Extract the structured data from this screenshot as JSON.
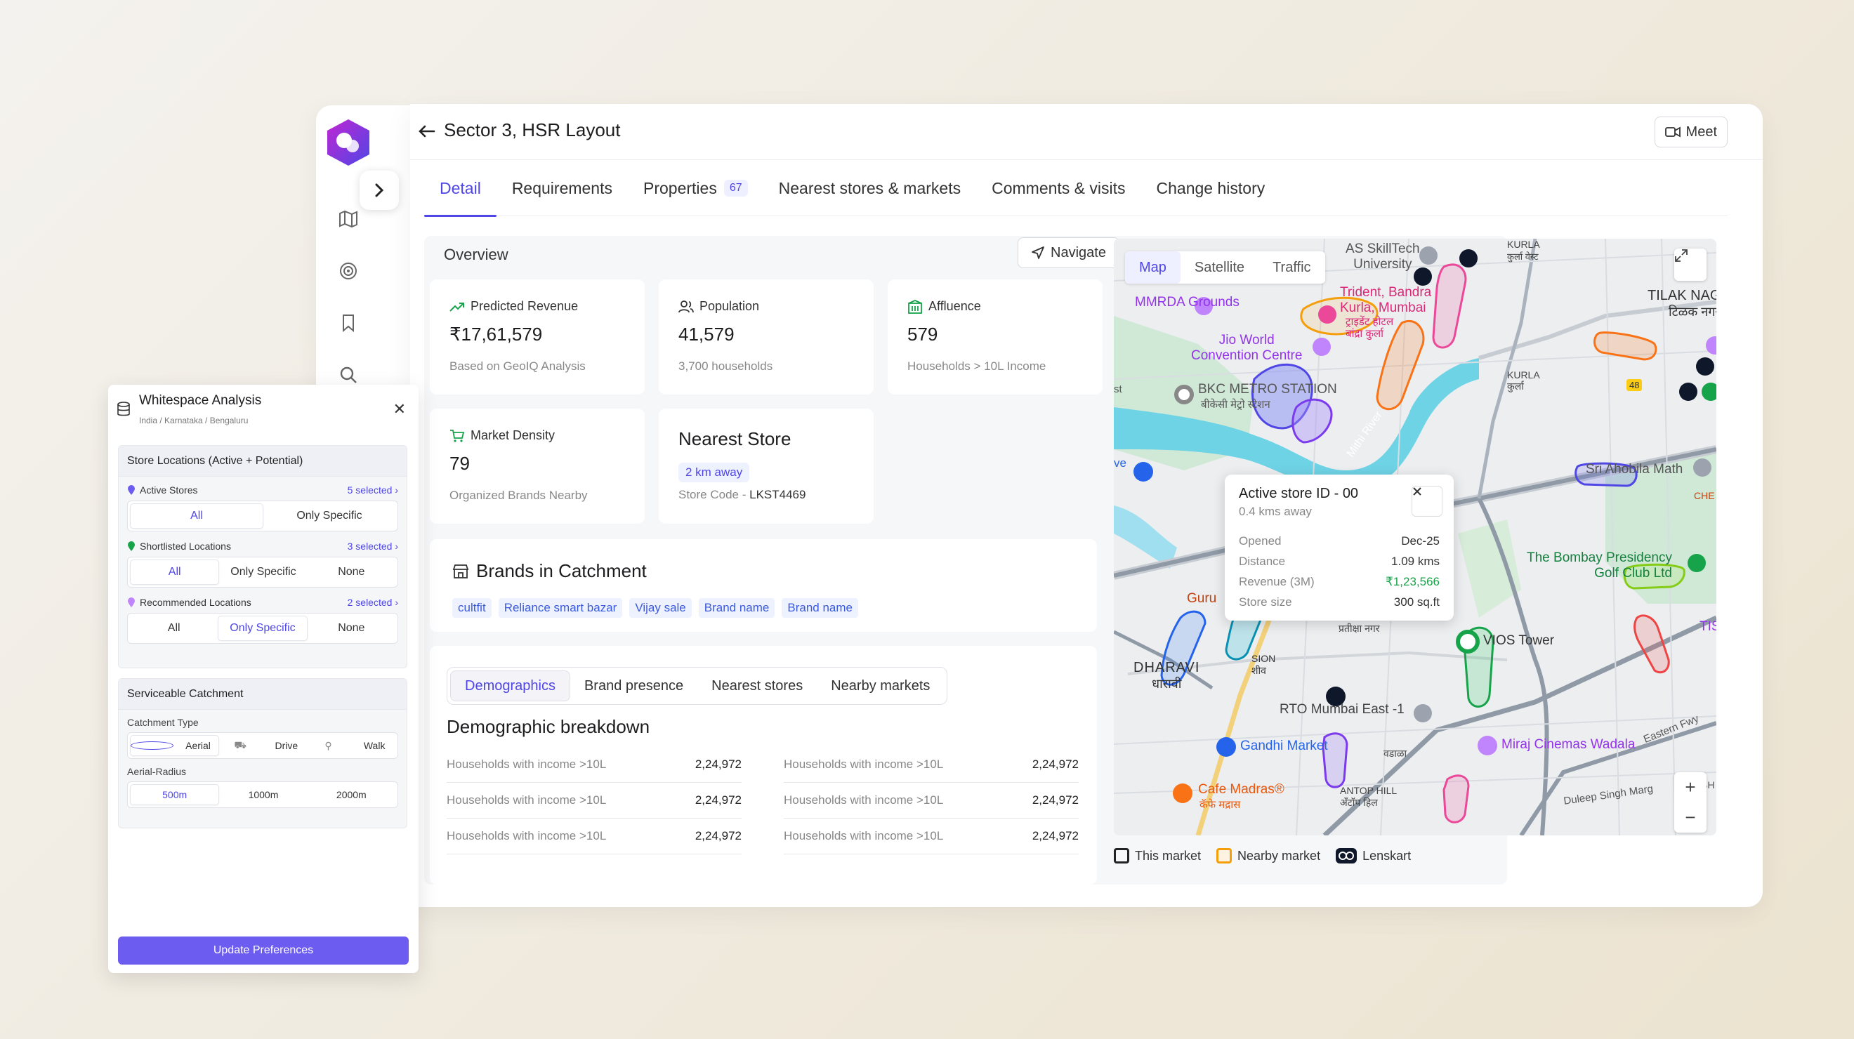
{
  "header": {
    "title": "Sector 3, HSR Layout",
    "meet_label": "Meet"
  },
  "tabs": [
    {
      "label": "Detail",
      "active": true
    },
    {
      "label": "Requirements"
    },
    {
      "label": "Properties",
      "count": "67"
    },
    {
      "label": "Nearest stores & markets"
    },
    {
      "label": "Comments & visits"
    },
    {
      "label": "Change history"
    }
  ],
  "overview": {
    "label": "Overview",
    "navigate_label": "Navigate",
    "cards": {
      "revenue": {
        "title": "Predicted Revenue",
        "value": "₹17,61,579",
        "sub": "Based on GeoIQ Analysis"
      },
      "population": {
        "title": "Population",
        "value": "41,579",
        "sub": "3,700 households"
      },
      "affluence": {
        "title": "Affluence",
        "value": "579",
        "sub": "Households > 10L Income"
      },
      "density": {
        "title": "Market Density",
        "value": "79",
        "sub": "Organized Brands Nearby"
      },
      "nearest": {
        "title": "Nearest Store",
        "distance": "2 km away",
        "code_label": "Store Code - ",
        "code": "LKST4469"
      }
    }
  },
  "brands": {
    "title": "Brands in Catchment",
    "items": [
      "cultfit",
      "Reliance smart bazar",
      "Vijay sale",
      "Brand name",
      "Brand name"
    ]
  },
  "demographics": {
    "tabs": [
      "Demographics",
      "Brand presence",
      "Nearest stores",
      "Nearby markets"
    ],
    "title": "Demographic breakdown",
    "rows": [
      {
        "label": "Households with income >10L",
        "value": "2,24,972"
      },
      {
        "label": "Households with income >10L",
        "value": "2,24,972"
      },
      {
        "label": "Households with income >10L",
        "value": "2,24,972"
      },
      {
        "label": "Households with income >10L",
        "value": "2,24,972"
      },
      {
        "label": "Households with income >10L",
        "value": "2,24,972"
      },
      {
        "label": "Households with income >10L",
        "value": "2,24,972"
      }
    ]
  },
  "map": {
    "types": [
      "Map",
      "Satellite",
      "Traffic"
    ],
    "labels": {
      "mmrda": "MMRDA Grounds",
      "jio": "Jio World\nConvention Centre",
      "bkc": "BKC METRO STATION",
      "bkc_hi": "बीकेसी मेट्रो स्टेशन",
      "trident": "Trident, Bandra\nKurla, Mumbai",
      "trident_hi": "ट्राइडेंट होटल\nबांद्रा कुर्ला",
      "skilltech": "AS SkillTech\nUniversity",
      "kurla": "KURLA",
      "kurla_hi": "कुर्ला वेस्ट",
      "tilak": "TILAK NAGA",
      "tilak_hi": "टिळक नगर",
      "kurla2": "KURLA\nकुर्ला",
      "mithi": "Mithi River",
      "ahobila": "Sri Ahobila Math",
      "chem": "CHE",
      "bombay": "The Bombay Presidency\nGolf Club Ltd",
      "tis": "TIS",
      "vios": "VIOS Tower",
      "guru": "Guru",
      "dharavi": "DHARAVI",
      "dharavi_hi": "धारावी",
      "sion": "SION\nशीव",
      "pratiksha": "प्रतीक्षा नगर",
      "rto": "RTO Mumbai East -1",
      "gandhi": "Gandhi Market",
      "miraj": "Miraj Cinemas Wadala",
      "eastern": "Eastern Fwy",
      "cafe": "Cafe Madras®",
      "cafe_hi": "कॅफे मद्रास",
      "antop": "ANTOP HILL\nअँटॉप हिल",
      "wadala": "वडाळा",
      "duleep": "Duleep Singh Marg",
      "ve": "ve",
      "st": "st",
      "bh": "BH",
      "route48": "48"
    },
    "popup": {
      "title": "Active store ID - 00",
      "subtitle": "0.4 kms away",
      "rows": [
        {
          "label": "Opened",
          "value": "Dec-25"
        },
        {
          "label": "Distance",
          "value": "1.09 kms"
        },
        {
          "label": "Revenue (3M)",
          "value": "₹1,23,566"
        },
        {
          "label": "Store size",
          "value": "300 sq.ft"
        }
      ]
    },
    "zoom_in": "+",
    "zoom_out": "−"
  },
  "legend": [
    {
      "label": "This market",
      "color": "#222222"
    },
    {
      "label": "Nearby market",
      "color": "#f59e0b"
    },
    {
      "label": "Lenskart",
      "color": "#0f172a"
    }
  ],
  "whitespace": {
    "title": "Whitespace Analysis",
    "breadcrumb": "India  /  Karnataka  /  Bengaluru",
    "store_locations": {
      "title": "Store Locations (Active + Potential)",
      "active": {
        "label": "Active Stores",
        "selected": "5 selected",
        "options": [
          "All",
          "Only Specific"
        ]
      },
      "shortlisted": {
        "label": "Shortlisted Locations",
        "selected": "3 selected",
        "options": [
          "All",
          "Only Specific",
          "None"
        ]
      },
      "recommended": {
        "label": "Recommended Locations",
        "selected": "2 selected",
        "options": [
          "All",
          "Only Specific",
          "None"
        ]
      }
    },
    "catchment": {
      "title": "Serviceable Catchment",
      "type_label": "Catchment Type",
      "types": [
        "Aerial",
        "Drive",
        "Walk"
      ],
      "radius_label": "Aerial-Radius",
      "radii": [
        "500m",
        "1000m",
        "2000m"
      ]
    },
    "update_label": "Update Preferences"
  },
  "colors": {
    "accent": "#4f46e5",
    "button": "#6d5cf0",
    "positive": "#16a34a"
  }
}
